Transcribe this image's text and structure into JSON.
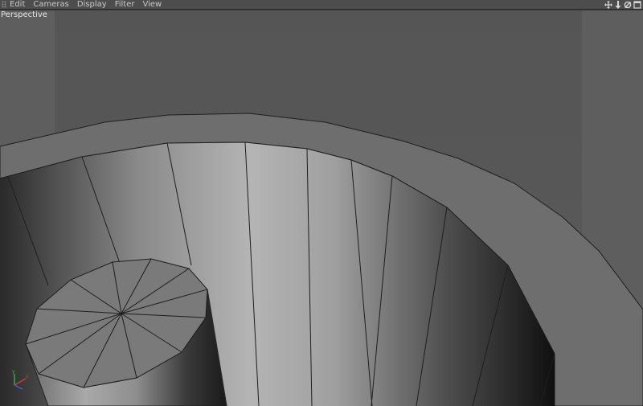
{
  "menu": {
    "items": [
      {
        "label": "Edit"
      },
      {
        "label": "Cameras"
      },
      {
        "label": "Display"
      },
      {
        "label": "Filter"
      },
      {
        "label": "View"
      }
    ]
  },
  "nav_icons": [
    "move-icon",
    "zoom-icon",
    "rotate-icon",
    "maximize-icon"
  ],
  "viewport": {
    "label": "Perspective"
  },
  "colors": {
    "background": "#555555",
    "menubar": "#4d4d4d",
    "wire": "#1e1e1e",
    "axis_x": "#d23c3c",
    "axis_y": "#3cb43c",
    "axis_z": "#3c64d2"
  }
}
